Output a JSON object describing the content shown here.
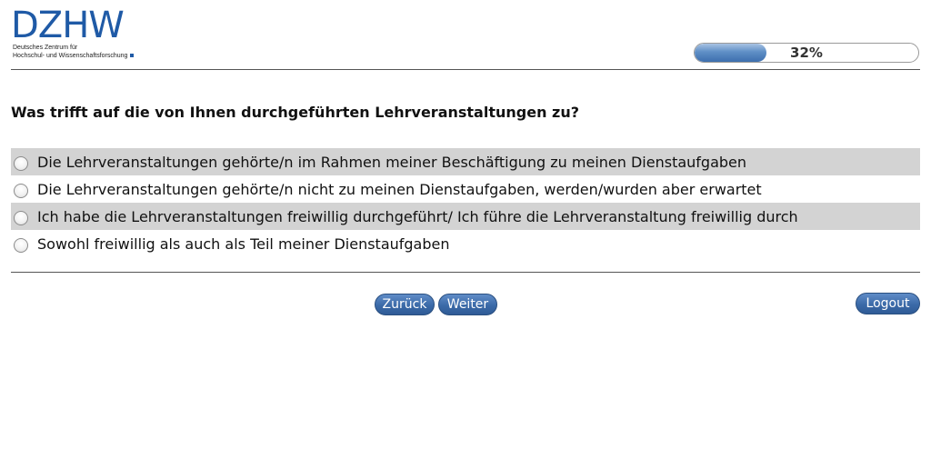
{
  "logo": {
    "wordmark": "DZHW",
    "subtitle_line1": "Deutsches Zentrum für",
    "subtitle_line2": "Hochschul- und Wissenschaftsforschung"
  },
  "progress": {
    "value": 0.32,
    "label": "32%"
  },
  "question": {
    "text": "Was trifft auf die von Ihnen durchgeführten Lehrveranstaltungen zu?"
  },
  "options": [
    {
      "label": "Die Lehrveranstaltungen gehörte/n im Rahmen meiner Beschäftigung zu meinen Dienstaufgaben"
    },
    {
      "label": "Die Lehrveranstaltungen gehörte/n nicht zu meinen Dienstaufgaben, werden/wurden aber erwartet"
    },
    {
      "label": "Ich habe die Lehrveranstaltungen freiwillig durchgeführt/ Ich führe die Lehrveranstaltung freiwillig durch"
    },
    {
      "label": "Sowohl freiwillig als auch als Teil meiner Dienstaufgaben"
    }
  ],
  "nav": {
    "back_label": "Zurück",
    "next_label": "Weiter",
    "logout_label": "Logout"
  },
  "colors": {
    "brand": "#1f5aa6",
    "button": "#3b6aa8",
    "row_shade": "#d3d3d3"
  }
}
